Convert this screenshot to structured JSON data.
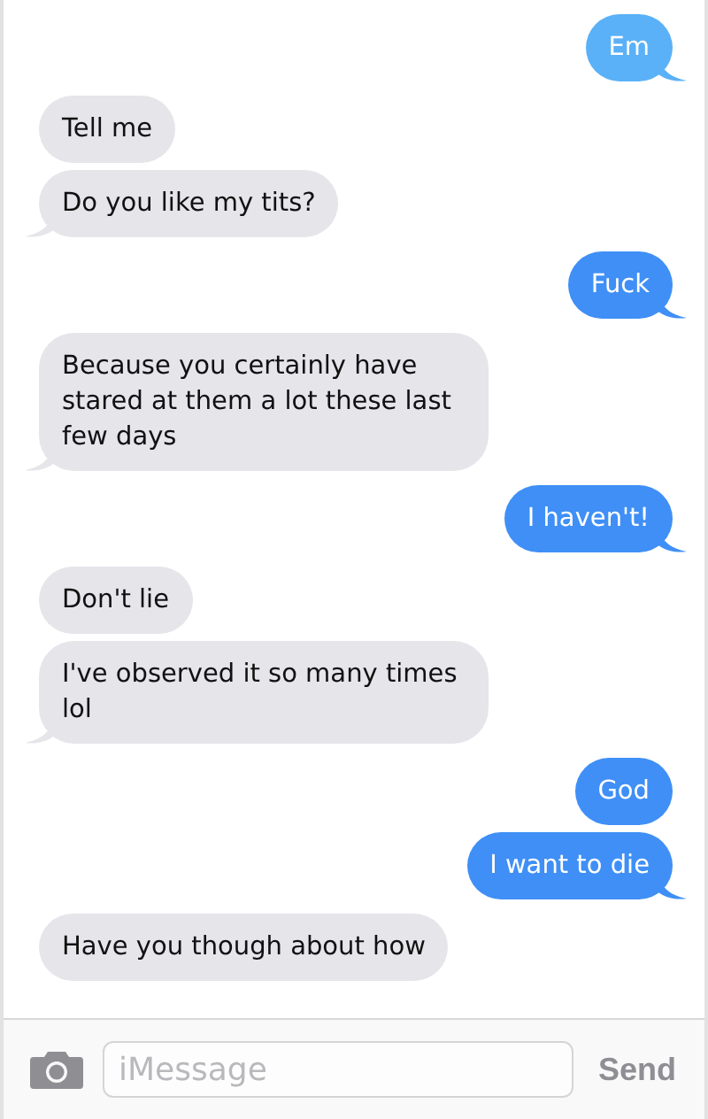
{
  "messages": [
    {
      "kind": "sent",
      "text": "Em",
      "tail": true,
      "color": "#5ab1f7"
    },
    {
      "kind": "received",
      "text": "Tell me",
      "tail": false,
      "color": "#e5e5ea"
    },
    {
      "kind": "received",
      "text": "Do you like my tits?",
      "tail": true,
      "color": "#e5e5ea"
    },
    {
      "kind": "sent",
      "text": "Fuck",
      "tail": true,
      "color": "#3f8ff6"
    },
    {
      "kind": "received",
      "text": "Because you certainly have stared at them a lot these last few days",
      "tail": true,
      "color": "#e5e5ea"
    },
    {
      "kind": "sent",
      "text": "I haven't!",
      "tail": true,
      "color": "#3f8ff6"
    },
    {
      "kind": "received",
      "text": "Don't lie",
      "tail": false,
      "color": "#e5e5ea"
    },
    {
      "kind": "received",
      "text": "I've observed it so many times lol",
      "tail": true,
      "color": "#e5e5ea"
    },
    {
      "kind": "sent",
      "text": "God",
      "tail": false,
      "color": "#3f8ff6"
    },
    {
      "kind": "sent",
      "text": "I want to die",
      "tail": true,
      "color": "#3f8ff6"
    },
    {
      "kind": "received",
      "text": "Have you though about how",
      "tail": false,
      "color": "#e5e5ea"
    }
  ],
  "composer": {
    "placeholder": "iMessage",
    "send": "Send"
  }
}
